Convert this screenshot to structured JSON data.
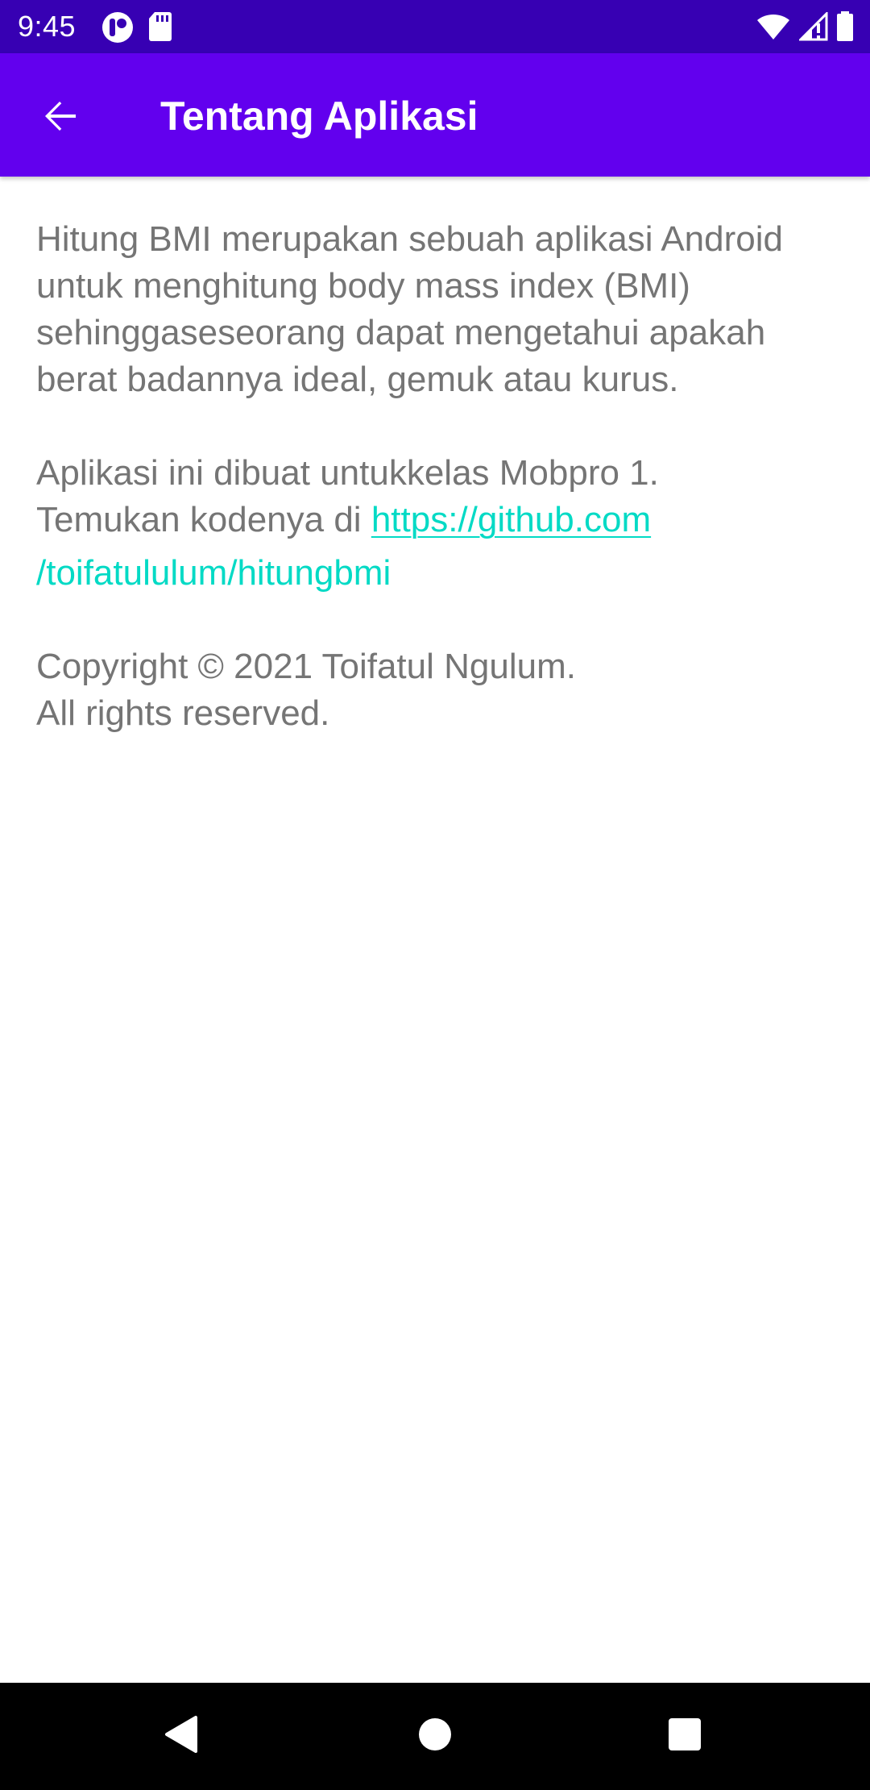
{
  "status_bar": {
    "time": "9:45",
    "background": "#3700b3",
    "left_icons": [
      "notification-app-icon",
      "sd-card-icon"
    ],
    "right_icons": [
      "wifi-icon",
      "signal-icon",
      "battery-icon"
    ]
  },
  "app_bar": {
    "title": "Tentang Aplikasi",
    "background": "#6200ee",
    "back_icon": "arrow-back-icon"
  },
  "content": {
    "text_color": "#757575",
    "link_color": "#03dac5",
    "paragraph_1": "Hitung BMI merupakan sebuah aplikasi Android untuk menghitung body mass index (BMI) sehinggaseseorang dapat mengetahui apakah berat badannya ideal, gemuk atau kurus.",
    "paragraph_2_line_1": "Aplikasi ini dibuat untukkelas Mobpro 1.",
    "paragraph_2_prefix": "Temukan kodenya di ",
    "link_line_1": "https://github.com",
    "link_line_2": "/toifatululum/hitungbmi",
    "copyright_line_1": "Copyright © 2021 Toifatul Ngulum.",
    "copyright_line_2": "All rights reserved."
  },
  "nav_bar": {
    "background": "#000000",
    "buttons": [
      "back-triangle-icon",
      "home-circle-icon",
      "recents-square-icon"
    ]
  }
}
